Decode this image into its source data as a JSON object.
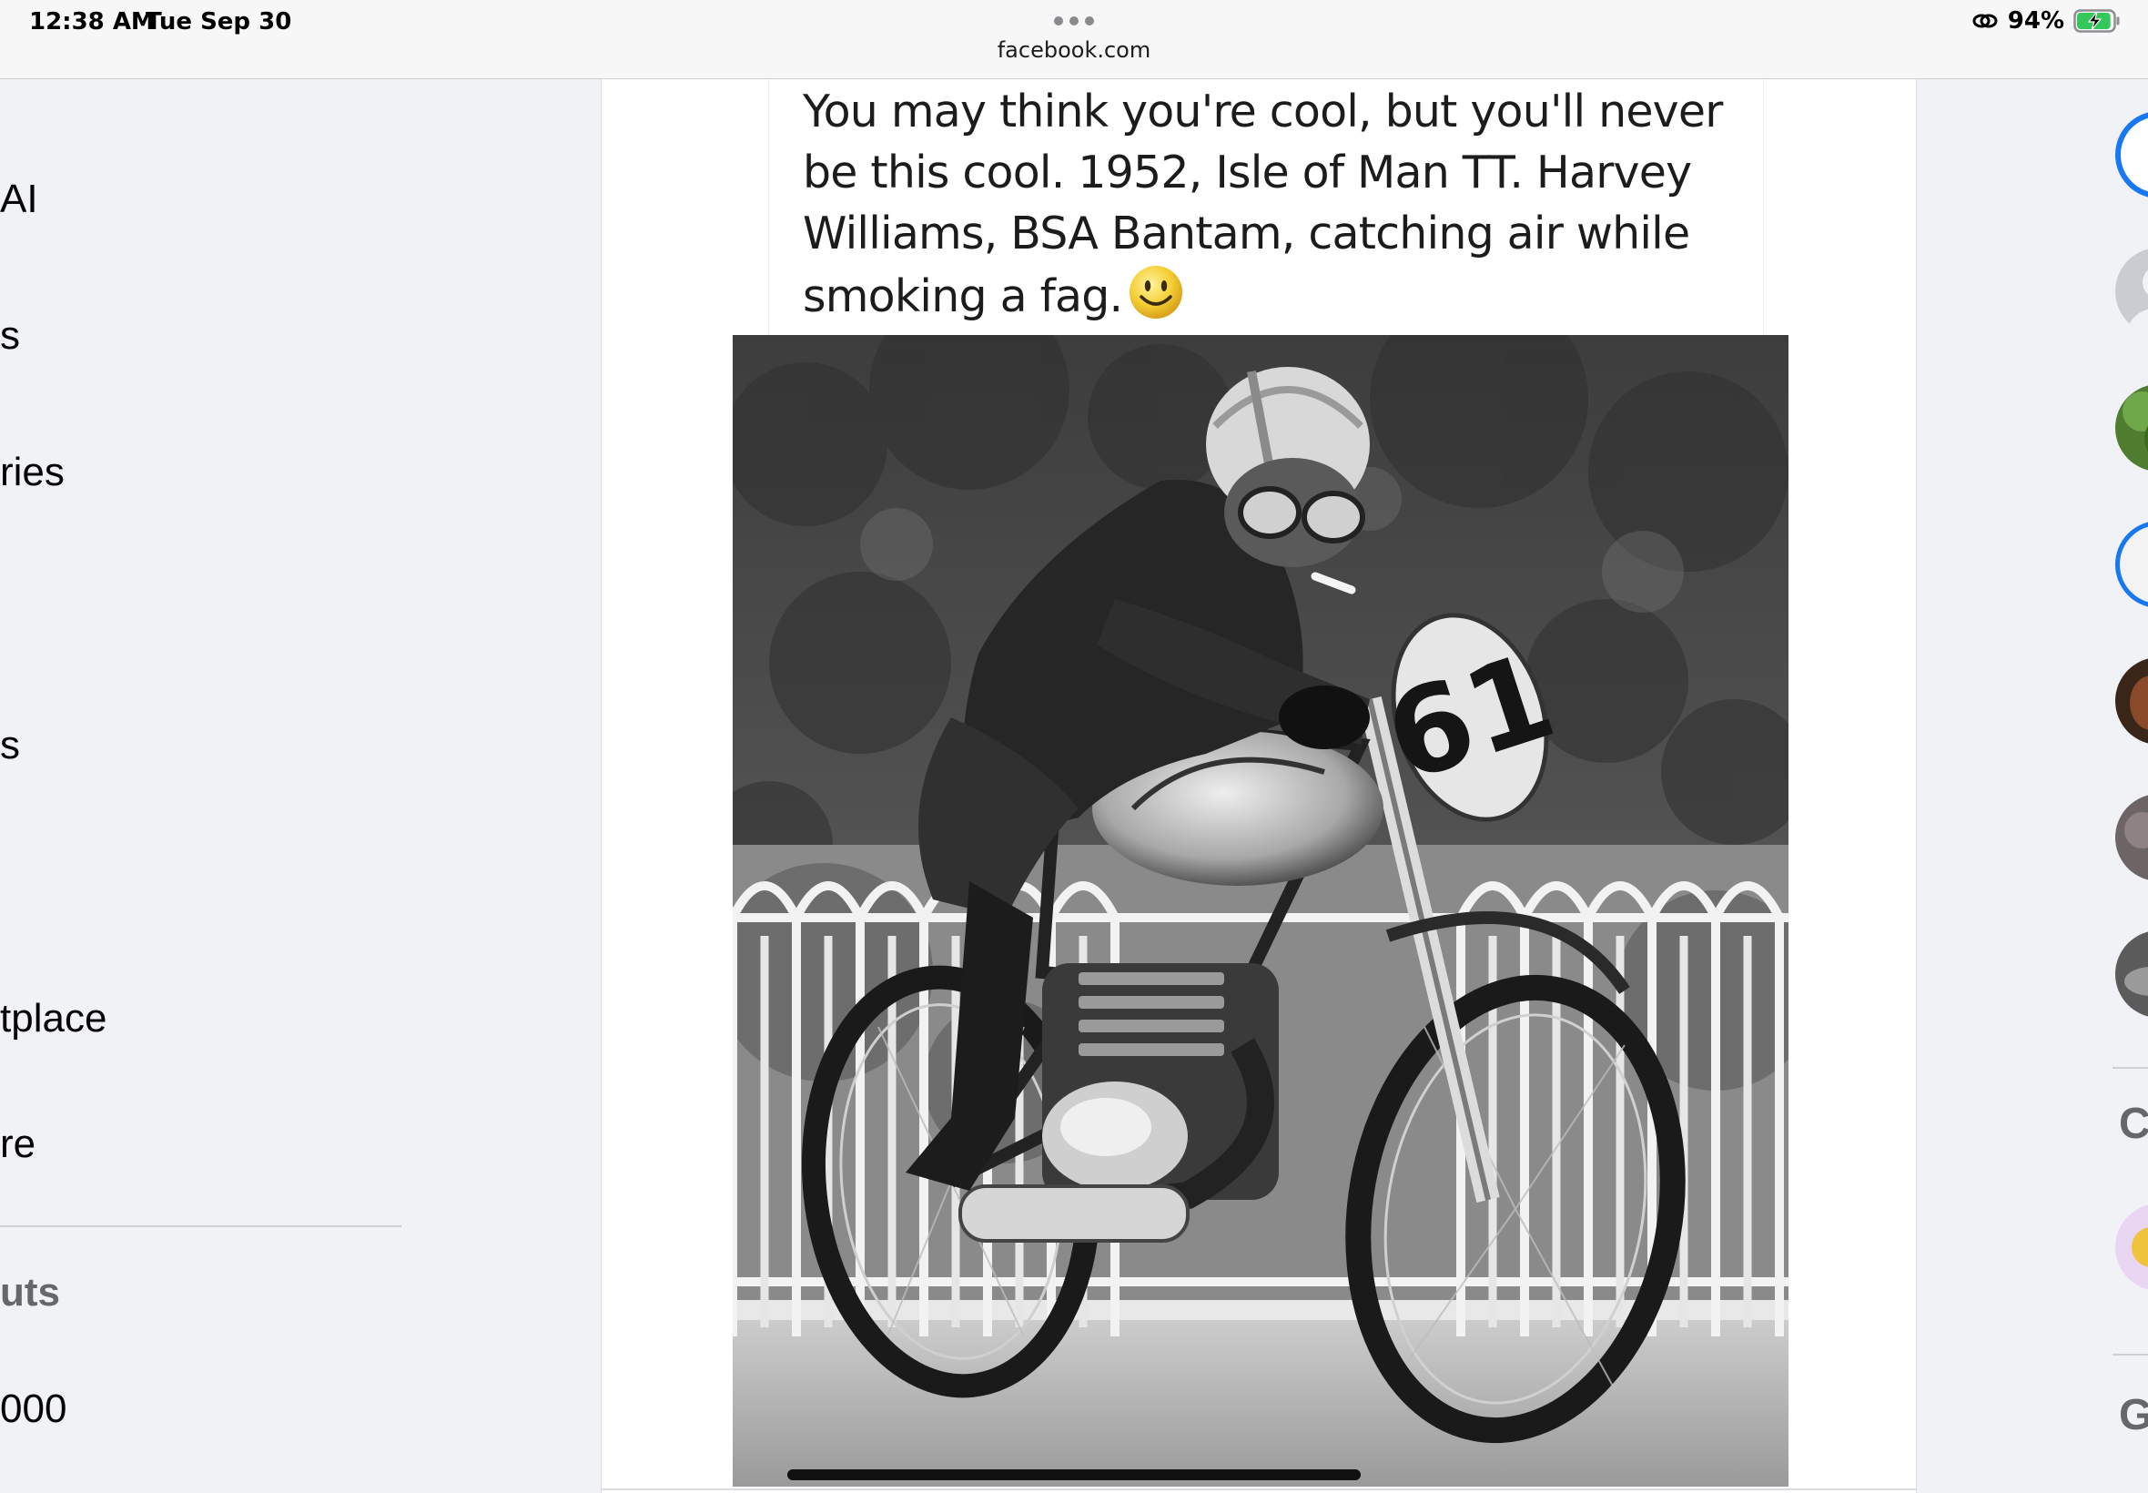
{
  "status_bar": {
    "time": "12:38 AM",
    "date": "Tue Sep 30",
    "battery_percent": "94%",
    "battery_level": 0.94,
    "url": "facebook.com"
  },
  "sidebar": {
    "items": [
      {
        "label": "AI"
      },
      {
        "label": "s"
      },
      {
        "label": "ries"
      },
      {
        "label": "s"
      },
      {
        "label": "tplace"
      },
      {
        "label": "re"
      }
    ],
    "shortcuts_heading": "uts",
    "shortcut_item": "000"
  },
  "post": {
    "caption": "You may think you're cool, but you'll never be this cool. 1952, Isle of Man TT. Harvey Williams, BSA Bantam, catching air while smoking a fag.",
    "photo_number_plate": "61"
  },
  "right_column": {
    "heading_1": "C",
    "heading_2": "G"
  },
  "colors": {
    "background": "#f0f2f5",
    "text": "#050505",
    "secondary_text": "#65676b",
    "battery_green": "#34c759",
    "messenger_blue": "#1877f2"
  },
  "icons": [
    "link-icon",
    "battery-charging-icon",
    "more-dots-icon",
    "smiley-emoji-icon"
  ]
}
